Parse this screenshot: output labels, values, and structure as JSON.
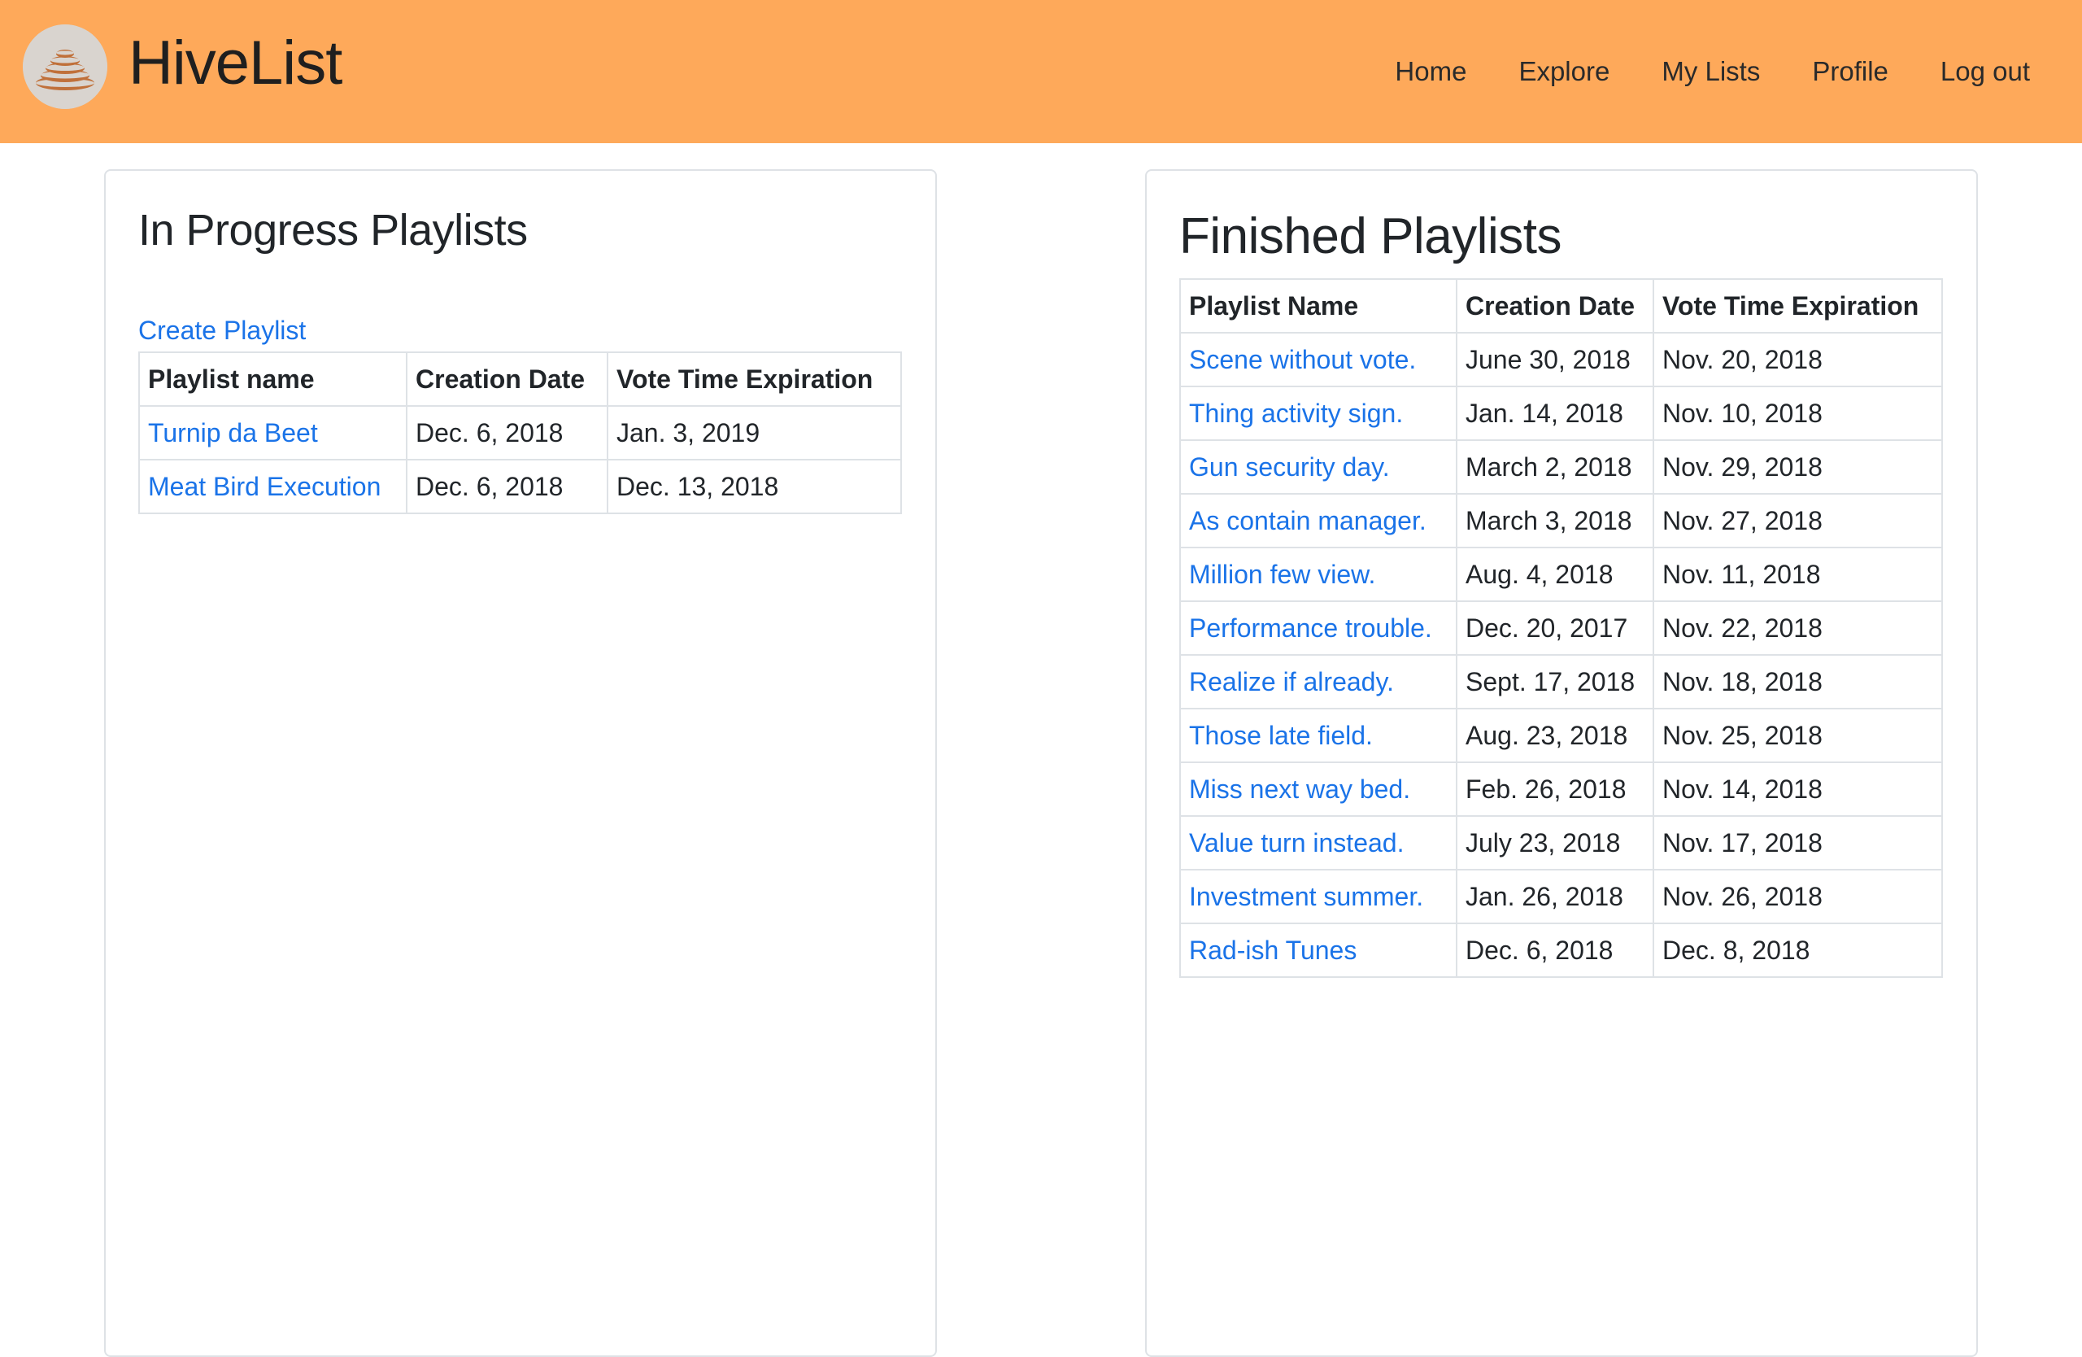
{
  "brand": {
    "name": "HiveList",
    "logo_icon": "hive-logo-icon"
  },
  "nav": {
    "items": [
      "Home",
      "Explore",
      "My Lists",
      "Profile",
      "Log out"
    ]
  },
  "in_progress": {
    "title": "In Progress Playlists",
    "create_link": "Create Playlist",
    "headers": [
      "Playlist name",
      "Creation Date",
      "Vote Time Expiration"
    ],
    "rows": [
      [
        "Turnip da Beet",
        "Dec. 6, 2018",
        "Jan. 3, 2019"
      ],
      [
        "Meat Bird Execution",
        "Dec. 6, 2018",
        "Dec. 13, 2018"
      ]
    ]
  },
  "finished": {
    "title": "Finished Playlists",
    "headers": [
      "Playlist Name",
      "Creation Date",
      "Vote Time Expiration"
    ],
    "rows": [
      [
        "Scene without vote.",
        "June 30, 2018",
        "Nov. 20, 2018"
      ],
      [
        "Thing activity sign.",
        "Jan. 14, 2018",
        "Nov. 10, 2018"
      ],
      [
        "Gun security day.",
        "March 2, 2018",
        "Nov. 29, 2018"
      ],
      [
        "As contain manager.",
        "March 3, 2018",
        "Nov. 27, 2018"
      ],
      [
        "Million few view.",
        "Aug. 4, 2018",
        "Nov. 11, 2018"
      ],
      [
        "Performance trouble.",
        "Dec. 20, 2017",
        "Nov. 22, 2018"
      ],
      [
        "Realize if already.",
        "Sept. 17, 2018",
        "Nov. 18, 2018"
      ],
      [
        "Those late field.",
        "Aug. 23, 2018",
        "Nov. 25, 2018"
      ],
      [
        "Miss next way bed.",
        "Feb. 26, 2018",
        "Nov. 14, 2018"
      ],
      [
        "Value turn instead.",
        "July 23, 2018",
        "Nov. 17, 2018"
      ],
      [
        "Investment summer.",
        "Jan. 26, 2018",
        "Nov. 26, 2018"
      ],
      [
        "Rad-ish Tunes",
        "Dec. 6, 2018",
        "Dec. 8, 2018"
      ]
    ]
  },
  "colors": {
    "navbar": "#fea95a",
    "link": "#1a73e8",
    "text": "#212529",
    "border": "#dee2e6",
    "logo_bg": "#d9d4cf",
    "logo_rings": "#c0703a"
  }
}
